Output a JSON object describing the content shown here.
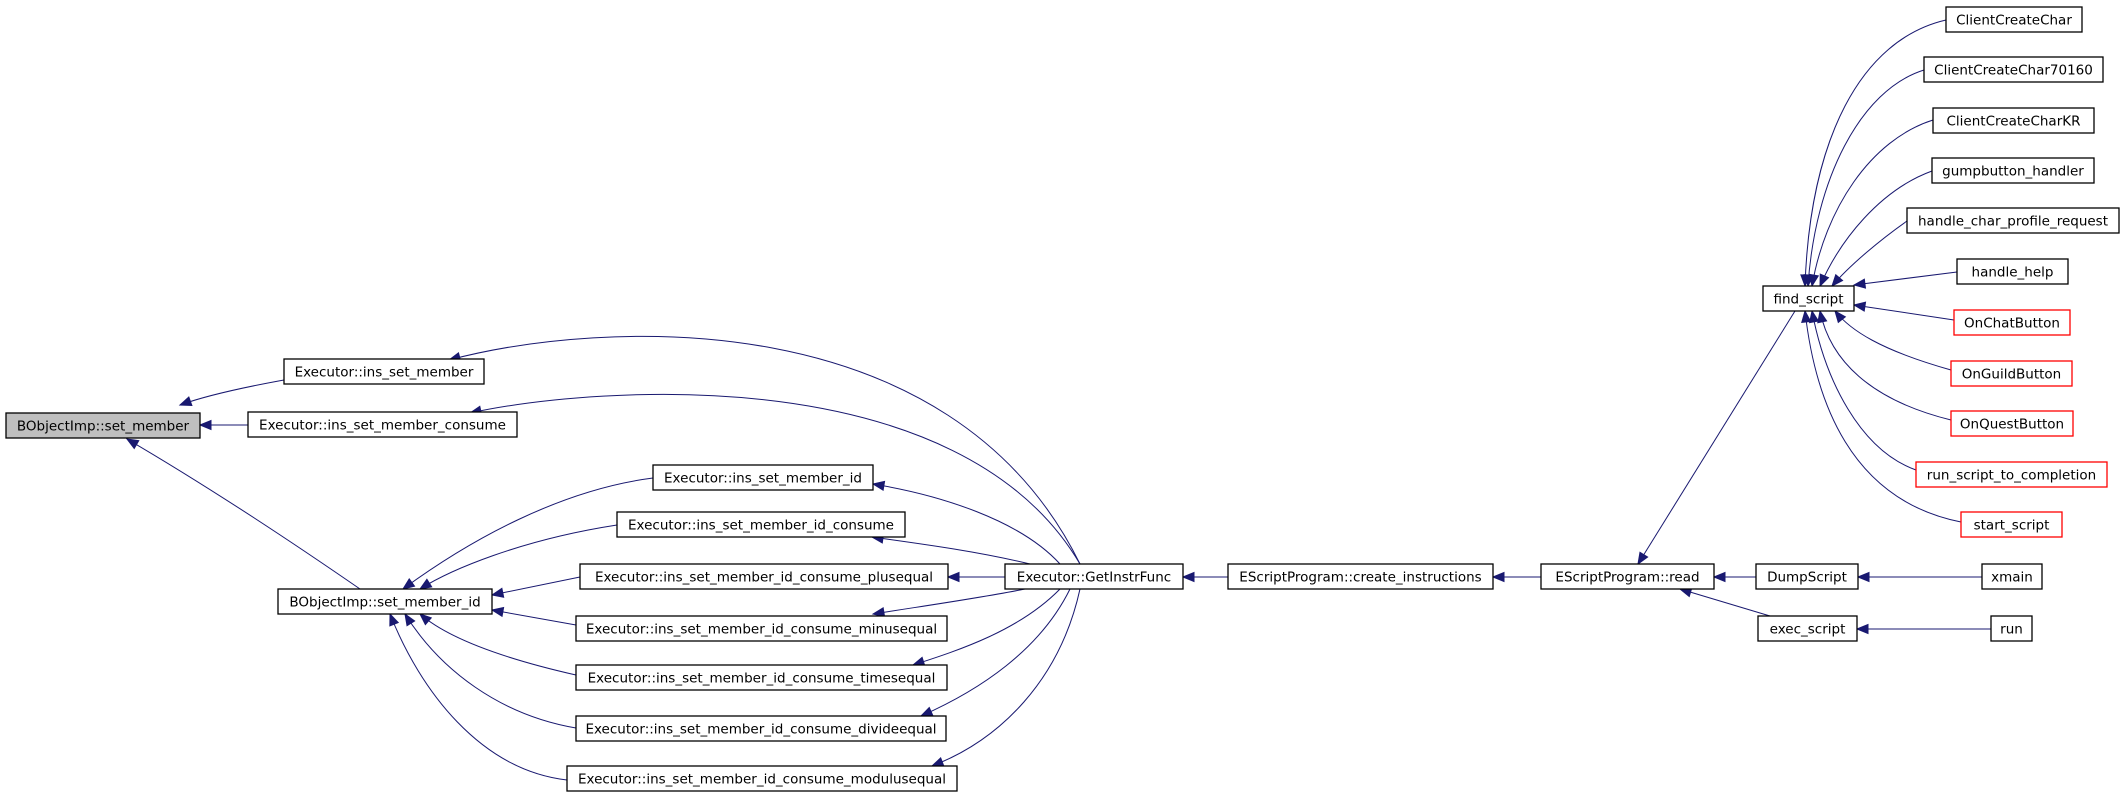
{
  "colors": {
    "edge": "#191970",
    "node_border": "#000000",
    "node_border_truncated": "#ff0000",
    "node_fill": "#ffffff",
    "node_fill_highlighted": "#bfbfbf",
    "text": "#000000"
  },
  "nodes": [
    {
      "id": "set_member",
      "label": "BObjectImp::set_member",
      "highlighted": true
    },
    {
      "id": "ins_set_member",
      "label": "Executor::ins_set_member"
    },
    {
      "id": "ins_set_member_consume",
      "label": "Executor::ins_set_member_consume"
    },
    {
      "id": "set_member_id",
      "label": "BObjectImp::set_member_id"
    },
    {
      "id": "ins_id",
      "label": "Executor::ins_set_member_id"
    },
    {
      "id": "ins_id_consume",
      "label": "Executor::ins_set_member_id_consume"
    },
    {
      "id": "ins_plusequal",
      "label": "Executor::ins_set_member_id_consume_plusequal"
    },
    {
      "id": "ins_minusequal",
      "label": "Executor::ins_set_member_id_consume_minusequal"
    },
    {
      "id": "ins_timesequal",
      "label": "Executor::ins_set_member_id_consume_timesequal"
    },
    {
      "id": "ins_divideequal",
      "label": "Executor::ins_set_member_id_consume_divideequal"
    },
    {
      "id": "ins_modulusequal",
      "label": "Executor::ins_set_member_id_consume_modulusequal"
    },
    {
      "id": "getinstrfunc",
      "label": "Executor::GetInstrFunc"
    },
    {
      "id": "create_instructions",
      "label": "EScriptProgram::create_instructions"
    },
    {
      "id": "read",
      "label": "EScriptProgram::read"
    },
    {
      "id": "find_script",
      "label": "find_script"
    },
    {
      "id": "dumpscript",
      "label": "DumpScript"
    },
    {
      "id": "exec_script",
      "label": "exec_script"
    },
    {
      "id": "cc_char",
      "label": "ClientCreateChar"
    },
    {
      "id": "cc_char70160",
      "label": "ClientCreateChar70160"
    },
    {
      "id": "cc_charkr",
      "label": "ClientCreateCharKR"
    },
    {
      "id": "gumpbutton",
      "label": "gumpbutton_handler"
    },
    {
      "id": "char_profile",
      "label": "handle_char_profile_request"
    },
    {
      "id": "handle_help",
      "label": "handle_help"
    },
    {
      "id": "onchat",
      "label": "OnChatButton",
      "truncated": true
    },
    {
      "id": "onguild",
      "label": "OnGuildButton",
      "truncated": true
    },
    {
      "id": "onquest",
      "label": "OnQuestButton",
      "truncated": true
    },
    {
      "id": "run_to_completion",
      "label": "run_script_to_completion",
      "truncated": true
    },
    {
      "id": "start_script",
      "label": "start_script",
      "truncated": true
    },
    {
      "id": "xmain",
      "label": "xmain"
    },
    {
      "id": "run",
      "label": "run"
    }
  ],
  "edges": [
    {
      "from": "ins_set_member",
      "to": "set_member"
    },
    {
      "from": "ins_set_member_consume",
      "to": "set_member"
    },
    {
      "from": "set_member_id",
      "to": "set_member"
    },
    {
      "from": "ins_id",
      "to": "set_member_id"
    },
    {
      "from": "ins_id_consume",
      "to": "set_member_id"
    },
    {
      "from": "ins_plusequal",
      "to": "set_member_id"
    },
    {
      "from": "ins_minusequal",
      "to": "set_member_id"
    },
    {
      "from": "ins_timesequal",
      "to": "set_member_id"
    },
    {
      "from": "ins_divideequal",
      "to": "set_member_id"
    },
    {
      "from": "ins_modulusequal",
      "to": "set_member_id"
    },
    {
      "from": "getinstrfunc",
      "to": "ins_set_member"
    },
    {
      "from": "getinstrfunc",
      "to": "ins_set_member_consume"
    },
    {
      "from": "getinstrfunc",
      "to": "ins_id"
    },
    {
      "from": "getinstrfunc",
      "to": "ins_id_consume"
    },
    {
      "from": "getinstrfunc",
      "to": "ins_plusequal"
    },
    {
      "from": "getinstrfunc",
      "to": "ins_minusequal"
    },
    {
      "from": "getinstrfunc",
      "to": "ins_timesequal"
    },
    {
      "from": "getinstrfunc",
      "to": "ins_divideequal"
    },
    {
      "from": "getinstrfunc",
      "to": "ins_modulusequal"
    },
    {
      "from": "create_instructions",
      "to": "getinstrfunc"
    },
    {
      "from": "read",
      "to": "create_instructions"
    },
    {
      "from": "find_script",
      "to": "read"
    },
    {
      "from": "dumpscript",
      "to": "read"
    },
    {
      "from": "exec_script",
      "to": "read"
    },
    {
      "from": "cc_char",
      "to": "find_script"
    },
    {
      "from": "cc_char70160",
      "to": "find_script"
    },
    {
      "from": "cc_charkr",
      "to": "find_script"
    },
    {
      "from": "gumpbutton",
      "to": "find_script"
    },
    {
      "from": "char_profile",
      "to": "find_script"
    },
    {
      "from": "handle_help",
      "to": "find_script"
    },
    {
      "from": "onchat",
      "to": "find_script"
    },
    {
      "from": "onguild",
      "to": "find_script"
    },
    {
      "from": "onquest",
      "to": "find_script"
    },
    {
      "from": "run_to_completion",
      "to": "find_script"
    },
    {
      "from": "start_script",
      "to": "find_script"
    },
    {
      "from": "xmain",
      "to": "dumpscript"
    },
    {
      "from": "run",
      "to": "exec_script"
    }
  ]
}
